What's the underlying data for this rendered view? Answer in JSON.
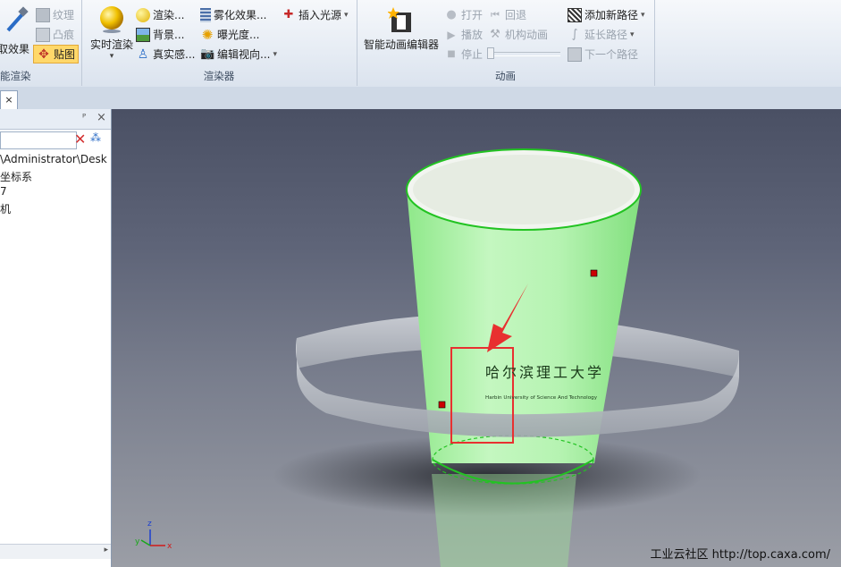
{
  "ribbon": {
    "group1": {
      "large_label": "取效果",
      "label": "能渲染",
      "items": [
        "纹理",
        "凸痕",
        "贴图"
      ]
    },
    "group2": {
      "large_label": "实时渲染",
      "label": "渲染器",
      "items": [
        "渲染...",
        "背景...",
        "真实感...",
        "雾化效果...",
        "曝光度...",
        "编辑视向...",
        "插入光源"
      ]
    },
    "group3": {
      "large_label": "智能动画编辑器",
      "label": "动画",
      "items": [
        "打开",
        "回退",
        "播放",
        "机构动画",
        "停止",
        "添加新路径",
        "延长路径",
        "下一个路径"
      ]
    }
  },
  "tabs": {
    "close": "×"
  },
  "panel": {
    "pin": "ᴾ",
    "close": "×",
    "tree": [
      "\\Administrator\\Desk",
      "坐标系",
      "7",
      "机"
    ]
  },
  "viewport": {
    "cup_text_cn": "哈尔滨理工大学",
    "cup_text_en": "Harbin University of Science And Technology",
    "axis_labels": {
      "z": "z",
      "x": "x",
      "y": "y"
    },
    "watermark": "工业云社区 http://top.caxa.com/"
  },
  "colors": {
    "cup": "#9df29a",
    "rim": "#22c322",
    "annotation": "#e83030"
  }
}
